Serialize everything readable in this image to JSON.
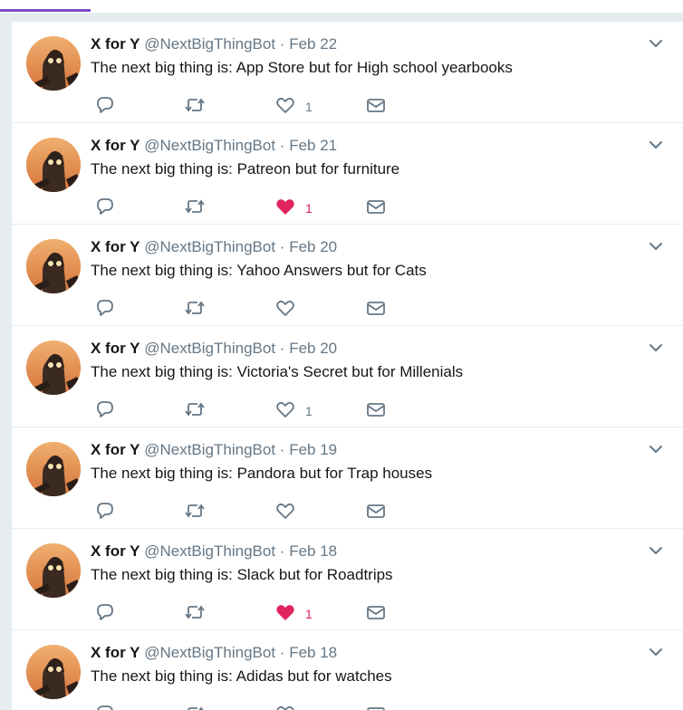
{
  "colors": {
    "accent": "#794bc4",
    "like_active": "#e0245e",
    "icon_gray": "#657786",
    "background": "#e6ecf0"
  },
  "tweets": [
    {
      "name": "X for Y",
      "handle": "@NextBigThingBot",
      "sep": "·",
      "date": "Feb 22",
      "text": "The next big thing is: App Store but for High school yearbooks",
      "like_count": "1",
      "liked": false
    },
    {
      "name": "X for Y",
      "handle": "@NextBigThingBot",
      "sep": "·",
      "date": "Feb 21",
      "text": "The next big thing is: Patreon but for furniture",
      "like_count": "1",
      "liked": true
    },
    {
      "name": "X for Y",
      "handle": "@NextBigThingBot",
      "sep": "·",
      "date": "Feb 20",
      "text": "The next big thing is: Yahoo Answers but for Cats",
      "like_count": "",
      "liked": false
    },
    {
      "name": "X for Y",
      "handle": "@NextBigThingBot",
      "sep": "·",
      "date": "Feb 20",
      "text": "The next big thing is: Victoria's Secret but for Millenials",
      "like_count": "1",
      "liked": false
    },
    {
      "name": "X for Y",
      "handle": "@NextBigThingBot",
      "sep": "·",
      "date": "Feb 19",
      "text": "The next big thing is: Pandora but for Trap houses",
      "like_count": "",
      "liked": false
    },
    {
      "name": "X for Y",
      "handle": "@NextBigThingBot",
      "sep": "·",
      "date": "Feb 18",
      "text": "The next big thing is: Slack but for Roadtrips",
      "like_count": "1",
      "liked": true
    },
    {
      "name": "X for Y",
      "handle": "@NextBigThingBot",
      "sep": "·",
      "date": "Feb 18",
      "text": "The next big thing is: Adidas but for watches",
      "like_count": "",
      "liked": false
    }
  ],
  "icons": {
    "reply": "reply-icon",
    "retweet": "retweet-icon",
    "like": "heart-icon",
    "dm": "envelope-icon",
    "more": "chevron-down-icon"
  }
}
